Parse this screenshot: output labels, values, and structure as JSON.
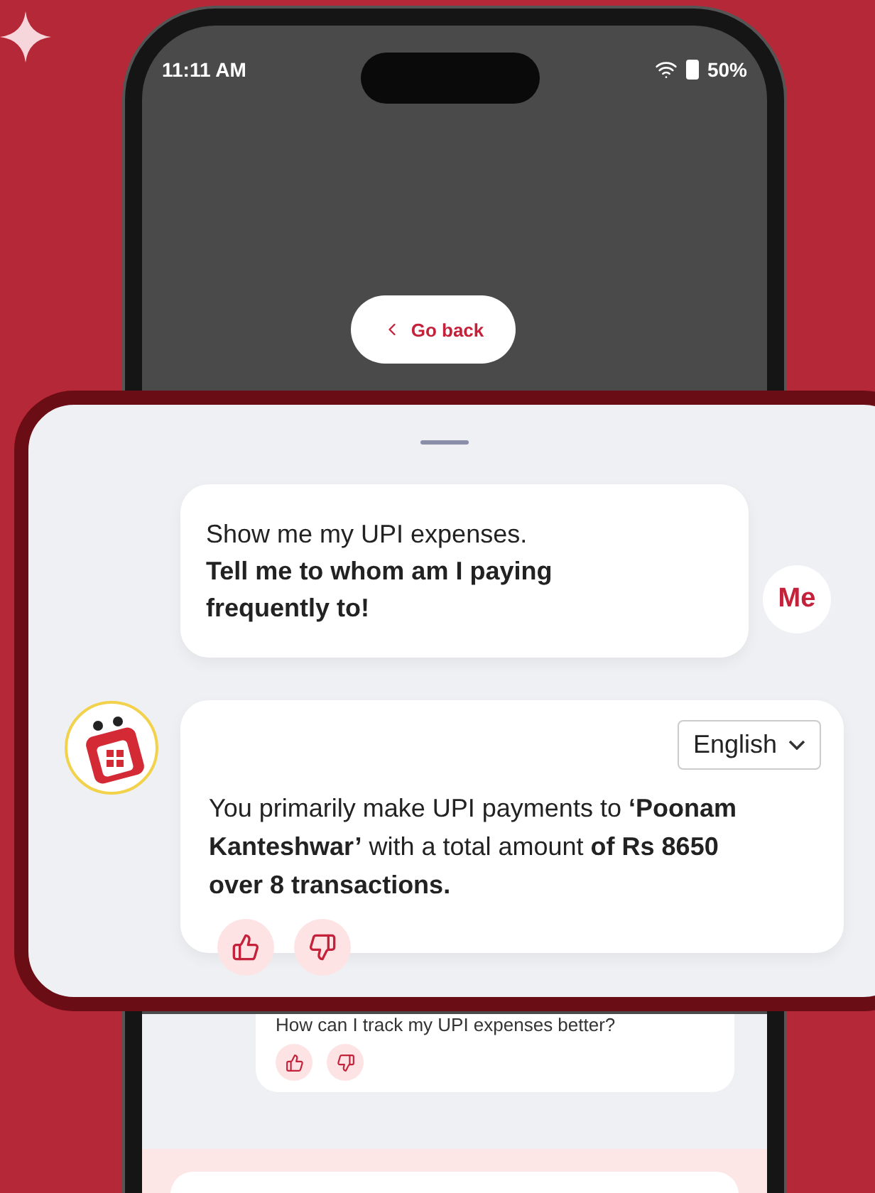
{
  "status_bar": {
    "time": "11:11 AM",
    "battery": "50%"
  },
  "back_button": {
    "label": "Go back"
  },
  "chat_sheet": {
    "messages": [
      {
        "kind": "user",
        "text": "Show me my UPI expenses.",
        "emphasis": "Tell me to whom am I paying frequently to!",
        "avatar": "Me"
      },
      {
        "kind": "bot",
        "language": "English",
        "text": "You primarily make UPI payments to **‘Poonam Kanteshwar’** with a total amount **of Rs 8650 over 8 transactions.**"
      }
    ]
  },
  "background_chat": {
    "suggestion": "How can I track my UPI expenses better?"
  }
}
